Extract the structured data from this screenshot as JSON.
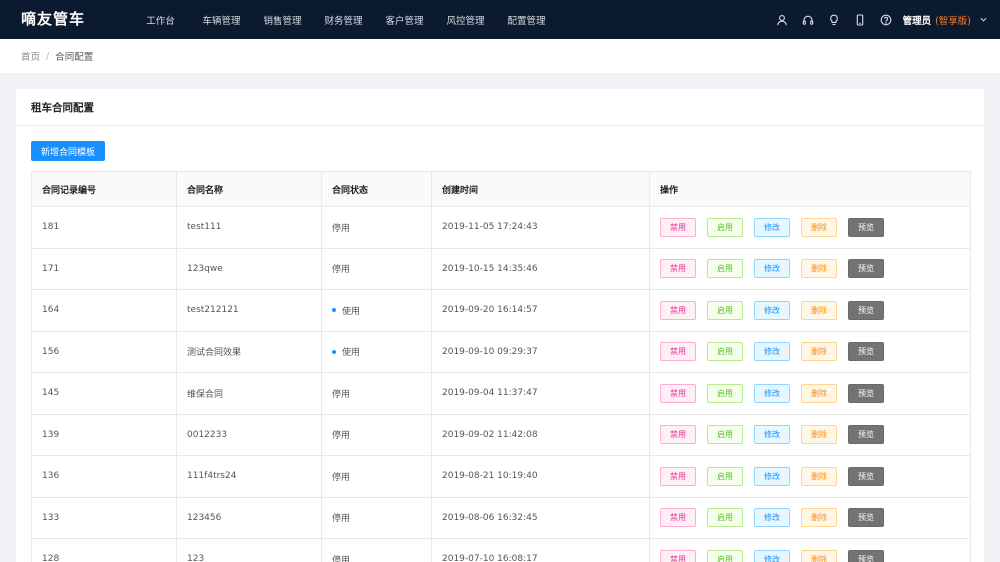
{
  "app": {
    "logo": "嘀友管车"
  },
  "nav": {
    "items": [
      "工作台",
      "车辆管理",
      "销售管理",
      "财务管理",
      "客户管理",
      "风控管理",
      "配置管理"
    ]
  },
  "header_icons": [
    "user-icon",
    "headset-icon",
    "bulb-icon",
    "mobile-icon",
    "help-icon"
  ],
  "user": {
    "name": "管理员",
    "edition": "(智享版)"
  },
  "breadcrumb": {
    "home": "首页",
    "separator": "/",
    "current": "合同配置"
  },
  "card": {
    "title": "租车合同配置"
  },
  "toolbar": {
    "add_label": "新增合同模板"
  },
  "table": {
    "columns": [
      "合同记录编号",
      "合同名称",
      "合同状态",
      "创建时间",
      "操作"
    ],
    "actions": {
      "disable": "禁用",
      "enable": "启用",
      "edit": "修改",
      "delete": "删除",
      "preview": "预览"
    },
    "rows": [
      {
        "id": "181",
        "name": "test111",
        "status": "停用",
        "active": false,
        "created": "2019-11-05 17:24:43"
      },
      {
        "id": "171",
        "name": "123qwe",
        "status": "停用",
        "active": false,
        "created": "2019-10-15 14:35:46"
      },
      {
        "id": "164",
        "name": "test212121",
        "status": "使用",
        "active": true,
        "created": "2019-09-20 16:14:57"
      },
      {
        "id": "156",
        "name": "测试合同效果",
        "status": "使用",
        "active": true,
        "created": "2019-09-10 09:29:37"
      },
      {
        "id": "145",
        "name": "维保合同",
        "status": "停用",
        "active": false,
        "created": "2019-09-04 11:37:47"
      },
      {
        "id": "139",
        "name": "0012233",
        "status": "停用",
        "active": false,
        "created": "2019-09-02 11:42:08"
      },
      {
        "id": "136",
        "name": "111f4trs24",
        "status": "停用",
        "active": false,
        "created": "2019-08-21 10:19:40"
      },
      {
        "id": "133",
        "name": "123456",
        "status": "停用",
        "active": false,
        "created": "2019-08-06 16:32:45"
      },
      {
        "id": "128",
        "name": "123",
        "status": "停用",
        "active": false,
        "created": "2019-07-10 16:08:17"
      }
    ]
  },
  "colors": {
    "topbar": "#0b1a2e",
    "primary": "#1890ff",
    "edition": "#ff7a2e"
  }
}
